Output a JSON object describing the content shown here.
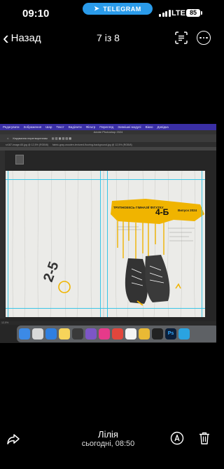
{
  "status_bar": {
    "time": "09:10",
    "telegram_label": "TELEGRAM",
    "network": "LTE",
    "battery": "85"
  },
  "nav": {
    "back_label": "Назад",
    "counter": "7 із 8"
  },
  "photoshop": {
    "menu": [
      "Редагувати",
      "Зображення",
      "Шар",
      "Текст",
      "Виділити",
      "Фільтр",
      "Перегляд",
      "Зовнішні модулі",
      "Вікно",
      "Довідка"
    ],
    "app_title": "Adobe Photoshop 2024",
    "options_label": "Керування перетворенням",
    "tabs": [
      "rz187-image-65.jpg @ 12,5% (RGB/8)",
      "fabric-gray-wooden-textured-flooring-background.jpg @ 12,5% (RGB/8)"
    ],
    "status": "12,5%"
  },
  "artwork": {
    "headline": "ТРУПНОЕКСЬ ГІМНАЗІЇ ФІГХТКУ",
    "class": "4-Б",
    "badge": "Випуск 2024",
    "left_number": "2-5"
  },
  "dock_icons": [
    "finder-icon",
    "launchpad-icon",
    "safari-icon",
    "notes-icon",
    "calculator-icon",
    "viber-icon",
    "app-icon",
    "app-icon-2",
    "chrome-icon",
    "app-icon-3",
    "photoshop-icon",
    "telegram-icon"
  ],
  "footer": {
    "author": "Лілія",
    "date": "сьогодні, 08:50"
  },
  "colors": {
    "accent_yellow": "#f0b400",
    "telegram_blue": "#2a9bea",
    "menu_purple": "#3a2fa5",
    "guides": "#39c6e6"
  }
}
